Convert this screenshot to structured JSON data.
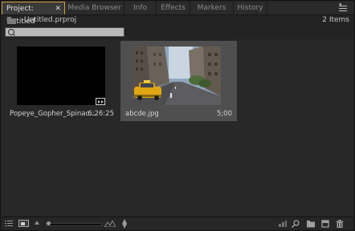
{
  "tabs": [
    {
      "label": "Project: Untitled",
      "active": true
    },
    {
      "label": "Media Browser",
      "active": false
    },
    {
      "label": "Info",
      "active": false
    },
    {
      "label": "Effects",
      "active": false
    },
    {
      "label": "Markers",
      "active": false
    },
    {
      "label": "History",
      "active": false
    }
  ],
  "header": {
    "project_file": "Untitled.prproj",
    "item_count": "2 Items"
  },
  "search": {
    "value": "",
    "placeholder": ""
  },
  "clips": [
    {
      "name": "Popeye_Gopher_Spinac...",
      "duration": "6:26:25",
      "type": "sequence"
    },
    {
      "name": "abcde.jpg",
      "duration": "5;00",
      "type": "still-image"
    }
  ],
  "footer": {
    "icons": [
      "list-view-icon",
      "icon-view-icon",
      "zoom-out-icon",
      "zoom-slider",
      "zoom-in-icon",
      "sort-icon",
      "automate-to-sequence-icon",
      "find-icon",
      "new-bin-icon",
      "new-item-icon",
      "clear-icon"
    ],
    "zoom_level": 0
  },
  "colors": {
    "active_tab_outline": "#c9a23a",
    "panel_bg": "#282828",
    "selected_clip_bg": "#4f4f4f"
  }
}
